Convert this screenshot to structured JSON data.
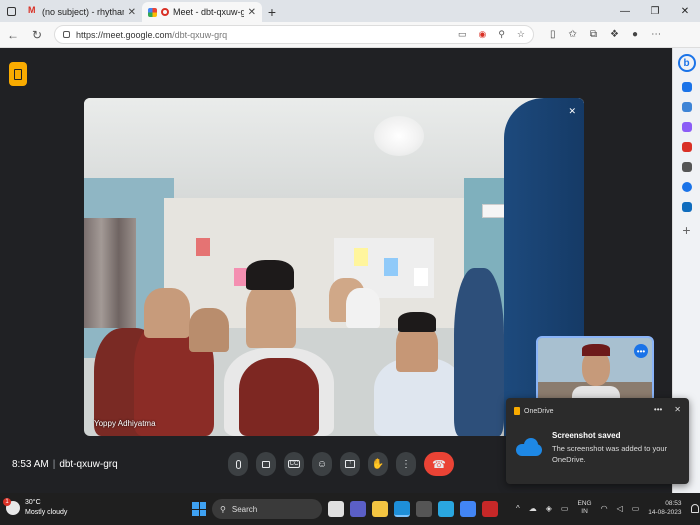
{
  "browser": {
    "tabs": [
      {
        "title": "(no subject) - rhytham@theindis",
        "icon": "gmail-icon",
        "active": false
      },
      {
        "title": "Meet - dbt-qxuw-grq",
        "icon": "meet-recording-icon",
        "active": true
      }
    ],
    "new_tab": "+",
    "window_controls": {
      "minimize": "—",
      "restore": "❐",
      "close": "✕"
    },
    "url_host": "https://meet.google.com",
    "url_path": "/dbt-qxuw-grq"
  },
  "meet": {
    "main_participant": "Yoppy Adhiyatma",
    "time": "8:53 AM",
    "meeting_code": "dbt-qxuw-grq",
    "self_more": "•••",
    "controls": [
      {
        "name": "mic-button",
        "icon": "microphone-icon"
      },
      {
        "name": "camera-button",
        "icon": "camera-icon"
      },
      {
        "name": "captions-button",
        "icon": "captions-icon",
        "label": "CC"
      },
      {
        "name": "emoji-button",
        "icon": "emoji-icon",
        "label": "☺"
      },
      {
        "name": "present-button",
        "icon": "present-icon",
        "label": "↑"
      },
      {
        "name": "raise-hand-button",
        "icon": "hand-icon",
        "label": "✋"
      },
      {
        "name": "more-options-button",
        "icon": "more-vertical-icon",
        "label": "⋮"
      },
      {
        "name": "hangup-button",
        "icon": "hangup-icon",
        "label": "☎"
      }
    ]
  },
  "toast": {
    "app": "OneDrive",
    "title": "Screenshot saved",
    "body": "The screenshot was added to your OneDrive.",
    "more": "•••",
    "close": "✕"
  },
  "taskbar": {
    "weather_badge": "1",
    "temperature": "30°C",
    "condition": "Mostly cloudy",
    "search_placeholder": "Search",
    "lang_line1": "ENG",
    "lang_line2": "IN",
    "clock_time": "08:53",
    "clock_date": "14-08-2023"
  },
  "colors": {
    "meet_bg": "#202124",
    "hangup": "#ea4335",
    "accent": "#8ab4f8",
    "activity": "#f9ab00"
  }
}
